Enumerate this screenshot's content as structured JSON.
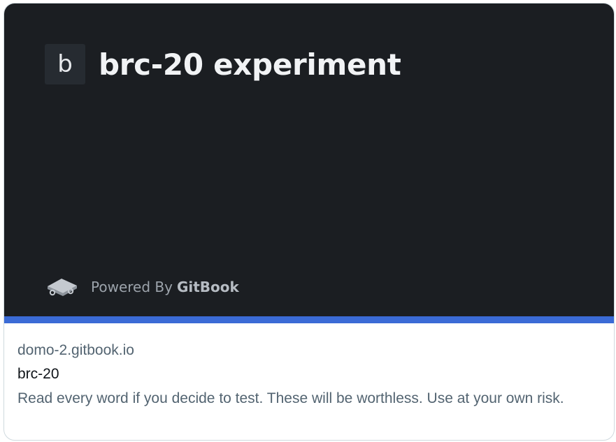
{
  "card": {
    "media": {
      "logo_letter": "b",
      "title": "brc-20 experiment",
      "powered_prefix": "Powered By",
      "powered_brand": "GitBook",
      "brand_icon": "gitbook-icon",
      "background_color": "#1b1e22",
      "accent_color": "#3b6bd6"
    },
    "domain": "domo-2.gitbook.io",
    "title": "brc-20",
    "description": "Read every word if you decide to test. These will be worthless. Use at your own risk."
  }
}
